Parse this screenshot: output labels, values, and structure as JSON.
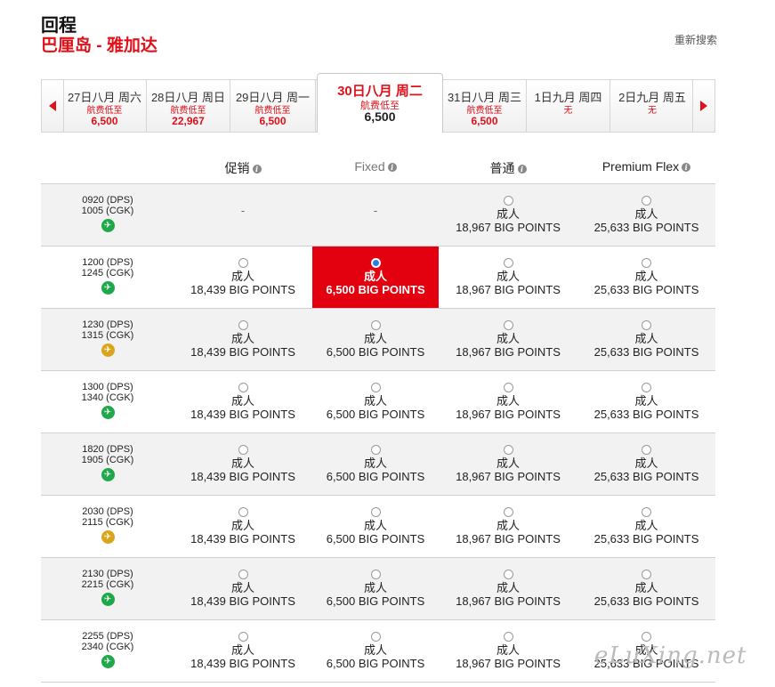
{
  "header": {
    "title": "回程",
    "route": "巴厘岛 - 雅加达",
    "research_link": "重新搜索"
  },
  "date_bar": {
    "prev_icon": "chevron-left-icon",
    "next_icon": "chevron-right-icon",
    "days": [
      {
        "label": "27日八月 周六",
        "fare_label": "航费低至",
        "price": "6,500"
      },
      {
        "label": "28日八月 周日",
        "fare_label": "航费低至",
        "price": "22,967"
      },
      {
        "label": "29日八月 周一",
        "fare_label": "航费低至",
        "price": "6,500"
      },
      {
        "label": "30日八月 周二",
        "fare_label": "航费低至",
        "price": "6,500"
      },
      {
        "label": "31日八月 周三",
        "fare_label": "航费低至",
        "price": "6,500"
      },
      {
        "label": "1日九月 周四",
        "fare_label": "无",
        "price": ""
      },
      {
        "label": "2日九月 周五",
        "fare_label": "无",
        "price": ""
      }
    ],
    "selected_index": 3
  },
  "columns": [
    {
      "label": "促销",
      "info_icon": "info-icon"
    },
    {
      "label": "Fixed",
      "info_icon": "info-icon"
    },
    {
      "label": "普通",
      "info_icon": "info-icon"
    },
    {
      "label": "Premium Flex",
      "info_icon": "info-icon"
    }
  ],
  "passenger_label": "成人",
  "flights": [
    {
      "dep": "0920 (DPS)",
      "arr": "1005 (CGK)",
      "icon_color": "green",
      "fares": [
        {
          "available": false,
          "text": "-"
        },
        {
          "available": false,
          "text": "-"
        },
        {
          "available": true,
          "points": "18,967 BIG POINTS"
        },
        {
          "available": true,
          "points": "25,633 BIG POINTS"
        }
      ]
    },
    {
      "dep": "1200 (DPS)",
      "arr": "1245 (CGK)",
      "icon_color": "green",
      "fares": [
        {
          "available": true,
          "points": "18,439 BIG POINTS"
        },
        {
          "available": true,
          "points": "6,500 BIG POINTS",
          "selected": true
        },
        {
          "available": true,
          "points": "18,967 BIG POINTS"
        },
        {
          "available": true,
          "points": "25,633 BIG POINTS"
        }
      ]
    },
    {
      "dep": "1230 (DPS)",
      "arr": "1315 (CGK)",
      "icon_color": "yellow",
      "fares": [
        {
          "available": true,
          "points": "18,439 BIG POINTS"
        },
        {
          "available": true,
          "points": "6,500 BIG POINTS"
        },
        {
          "available": true,
          "points": "18,967 BIG POINTS"
        },
        {
          "available": true,
          "points": "25,633 BIG POINTS"
        }
      ]
    },
    {
      "dep": "1300 (DPS)",
      "arr": "1340 (CGK)",
      "icon_color": "green",
      "fares": [
        {
          "available": true,
          "points": "18,439 BIG POINTS"
        },
        {
          "available": true,
          "points": "6,500 BIG POINTS"
        },
        {
          "available": true,
          "points": "18,967 BIG POINTS"
        },
        {
          "available": true,
          "points": "25,633 BIG POINTS"
        }
      ]
    },
    {
      "dep": "1820 (DPS)",
      "arr": "1905 (CGK)",
      "icon_color": "green",
      "fares": [
        {
          "available": true,
          "points": "18,439 BIG POINTS"
        },
        {
          "available": true,
          "points": "6,500 BIG POINTS"
        },
        {
          "available": true,
          "points": "18,967 BIG POINTS"
        },
        {
          "available": true,
          "points": "25,633 BIG POINTS"
        }
      ]
    },
    {
      "dep": "2030 (DPS)",
      "arr": "2115 (CGK)",
      "icon_color": "yellow",
      "fares": [
        {
          "available": true,
          "points": "18,439 BIG POINTS"
        },
        {
          "available": true,
          "points": "6,500 BIG POINTS"
        },
        {
          "available": true,
          "points": "18,967 BIG POINTS"
        },
        {
          "available": true,
          "points": "25,633 BIG POINTS"
        }
      ]
    },
    {
      "dep": "2130 (DPS)",
      "arr": "2215 (CGK)",
      "icon_color": "green",
      "fares": [
        {
          "available": true,
          "points": "18,439 BIG POINTS"
        },
        {
          "available": true,
          "points": "6,500 BIG POINTS"
        },
        {
          "available": true,
          "points": "18,967 BIG POINTS"
        },
        {
          "available": true,
          "points": "25,633 BIG POINTS"
        }
      ]
    },
    {
      "dep": "2255 (DPS)",
      "arr": "2340 (CGK)",
      "icon_color": "green",
      "fares": [
        {
          "available": true,
          "points": "18,439 BIG POINTS"
        },
        {
          "available": true,
          "points": "6,500 BIG POINTS"
        },
        {
          "available": true,
          "points": "18,967 BIG POINTS"
        },
        {
          "available": true,
          "points": "25,633 BIG POINTS"
        }
      ]
    }
  ],
  "colors": {
    "accent": "#e0101a",
    "selected_cell": "#e3000f",
    "plane_green": "#1fa84a",
    "plane_yellow": "#d8a51d"
  },
  "watermark": "eLuXing.net"
}
